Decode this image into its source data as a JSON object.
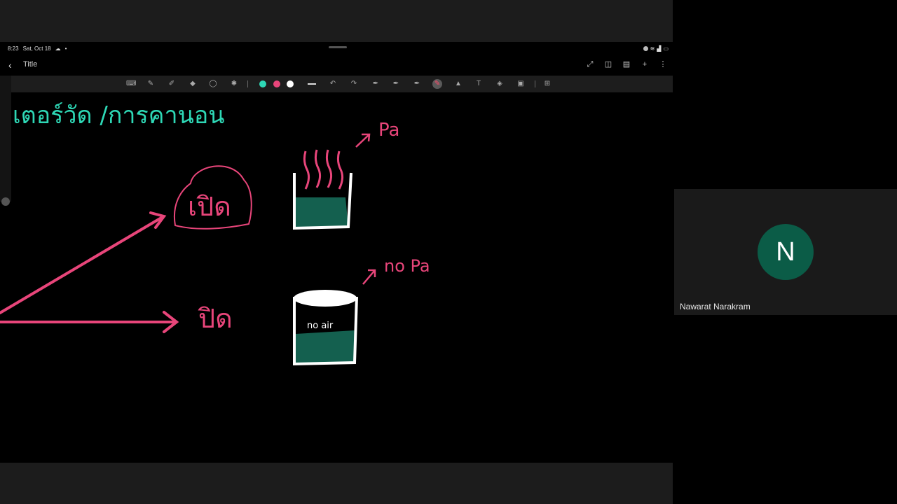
{
  "status_bar": {
    "time": "8:23",
    "date": "Sat, Oct 18"
  },
  "note": {
    "title": "Title"
  },
  "toolbar": {
    "colors": [
      "#2ed8b6",
      "#e8457a",
      "#ffffff"
    ],
    "active_tool": "highlighter"
  },
  "drawing": {
    "heading": "เตอร์วัด /การคานอน",
    "open_label": "เปิด",
    "closed_label": "ปิด",
    "pa_top": "Pa",
    "pa_bottom": "no Pa",
    "jar_text": "no air",
    "ink_colors": {
      "pink": "#e8457a",
      "teal": "#2ed8b6",
      "water": "#14604f",
      "white": "#ffffff"
    }
  },
  "participant": {
    "initial": "N",
    "name": "Nawarat Narakram",
    "avatar_color": "#0b5c47"
  }
}
